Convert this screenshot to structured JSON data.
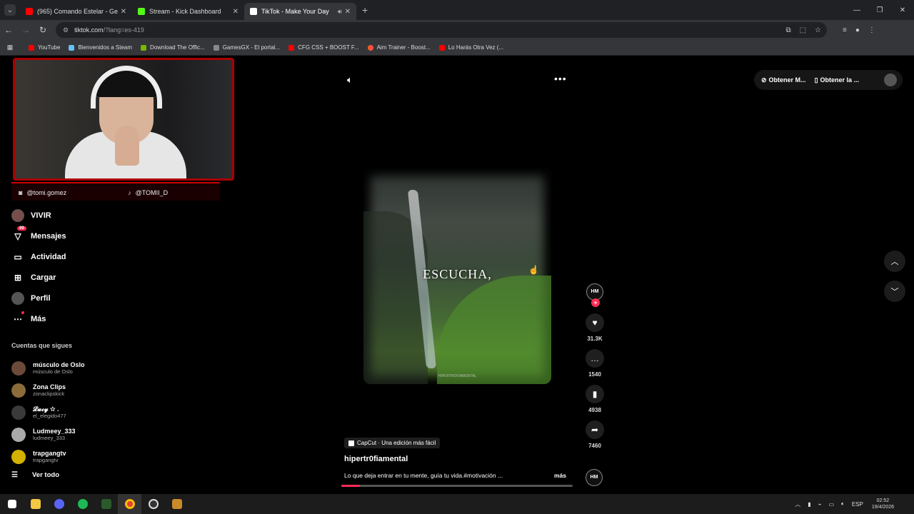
{
  "tabs": [
    {
      "title": "(965) Comando Estelar - Ge",
      "fav_color": "#ff0000",
      "active": false
    },
    {
      "title": "Stream - Kick Dashboard",
      "fav_color": "#53fc18",
      "active": false
    },
    {
      "title": "TikTok - Make Your Day",
      "fav_color": "#ffffff",
      "active": true
    }
  ],
  "address": {
    "domain": "tiktok.com",
    "path": "/?lang=es-419"
  },
  "bookmarks": [
    {
      "label": "YouTube",
      "color": "#ff0000"
    },
    {
      "label": "Bienvenidos a Steam",
      "color": "#1b2838"
    },
    {
      "label": "Download The Offic...",
      "color": "#76b900"
    },
    {
      "label": "GamesGX - El portal...",
      "color": "#444444"
    },
    {
      "label": "CFG CSS + BOOST F...",
      "color": "#ff0000"
    },
    {
      "label": "Aim Trainer - Boost...",
      "color": "#ff5533"
    },
    {
      "label": "Lo Harás Otra Vez (...",
      "color": "#ff0000"
    }
  ],
  "socials": {
    "instagram": "@tomi.gomez",
    "tiktok": "@TOMII_D"
  },
  "sidebar": {
    "live": "VIVIR",
    "messages": "Mensajes",
    "messages_badge": "99",
    "activity": "Actividad",
    "upload": "Cargar",
    "profile": "Perfil",
    "more": "Más"
  },
  "following": {
    "title": "Cuentas que sigues",
    "accounts": [
      {
        "name": "músculo de Oslo",
        "user": "músculo de Oslo",
        "color": "#6b4a3a"
      },
      {
        "name": "Zona Clips",
        "user": "zonaclipskick",
        "color": "#8a6b3a"
      },
      {
        "name": "𝓛𝓾𝓬𝔂 ☆ .",
        "user": "el_elegido477",
        "color": "#3a3a3a"
      },
      {
        "name": "Ludmeey_333",
        "user": "ludmeey_333",
        "color": "#aaaaaa"
      },
      {
        "name": "trapgangtv",
        "user": "trapgangtv",
        "color": "#d4b000"
      }
    ],
    "see_all": "Ver todo"
  },
  "video": {
    "overlay_text": "ESCUCHA,",
    "watermark": "HIPERTROFIAMENTAL",
    "capcut": "CapCut · Una edición más fácil",
    "author": "hipertr0fiamental",
    "description": "Lo que deja entrar en tu mente, guía tu vida.#motivación ...",
    "more": "más",
    "progress": 0.08,
    "avatar_label": "HM"
  },
  "actions": {
    "likes": "31.3K",
    "comments": "1540",
    "saves": "4938",
    "shares": "7460"
  },
  "topright": {
    "get_coins": "Obtener M...",
    "get_app": "Obtener la ..."
  },
  "taskbar": {
    "lang": "ESP",
    "time": "02:52",
    "date": "19/4/2026"
  }
}
